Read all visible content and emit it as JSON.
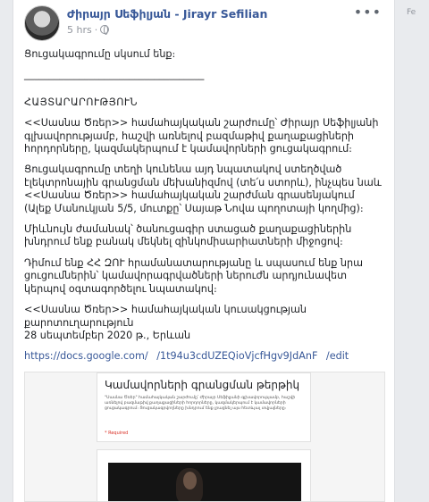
{
  "post": {
    "author": "Ժիրայր Սեֆիլյան - Jirayr Sefilian",
    "time": "5 hrs",
    "separator": "·",
    "more_label": "•••",
    "paragraphs": [
      "Ցուցակագրումը սկսում ենք։",
      "____________________________________",
      "ՀԱՅՏԱՐԱՐՈՒԹՅՈՒՆ",
      "<<Սասնա Ծռեր>> համահայկական շարժումը՝ Ժիրայր Սեֆիլյանի գլխավորությամբ, հաշվի առնելով բազմաթիվ քաղաքացիների հորդորները, կազմակերպում է կամավորների ցուցակագրում։",
      "Ցուցակագրումը տեղի կունենա այդ նպատակով ստեղծված էլեկտրոնային գրանցման մեխանիզմով (տե՛ս ստորև), ինչպես նաև <<Սասնա Ծռեր>> համահայկական շարժման գրասենյակում (Ալեք Մանուկյան 5/5, մուտքը՝ Սայաթ Նովա պողոտայի կողմից)։",
      "Միևնույն ժամանակ՝ ծանուցագիր ստացած քաղաքացիներին խնդրում ենք բանակ մեկնել զինկոմիսարիատների միջոցով։",
      "Դիմում ենք ՀՀ ԶՈՒ հրամանատարությանը և սպասում ենք նրա ցուցումներին՝ կամավորագրվածների ներուժն արդյունավետ կերպով օգտագործելու նպատակով։"
    ],
    "signature_line1": "<<Սասնա Ծռեր>> համահայկական կուսակցության",
    "signature_line2": "քարոտուղարություն",
    "date_line": "28 սեպտեմբեր 2020 թ., Երևան",
    "link": "https://docs.google.com/ /1t94u3cdUZEQioVjcfHgv9JdAnF /edit"
  },
  "preview": {
    "title": "Կամավորների գրանցման թերթիկ",
    "body": "\"Սասնա Ծռեր\" համահայկական շարժումը՝ Ժիրայր Սեֆիլյանի գլխավորությամբ, հաշվի առնելով բազմաթիվ քաղաքացիների հորդորները, կազմակերպում է կամավորների ցուցակագրում։ Ցուցակագրվողները խնդրում ենք լրացնել այս հետևյալ տվյալները։",
    "required": "* Required"
  },
  "sidebar": {
    "text": "Fe"
  },
  "colors": {
    "author": "#385898",
    "link": "#385898",
    "meta": "#90949c",
    "required": "#d93025"
  }
}
